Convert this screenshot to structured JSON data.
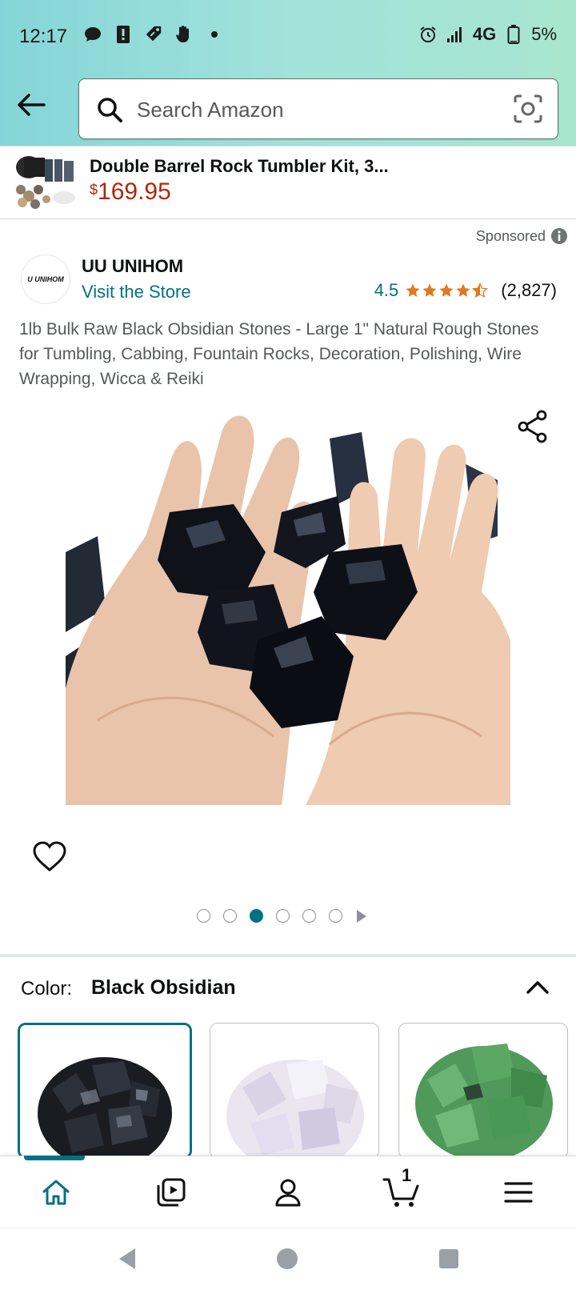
{
  "status_bar": {
    "time": "12:17",
    "network": "4G",
    "battery": "5%"
  },
  "header": {
    "search_placeholder": "Search Amazon"
  },
  "promo": {
    "title": "Double Barrel Rock Tumbler Kit, 3...",
    "price_currency": "$",
    "price_value": "169.95"
  },
  "sponsored_label": "Sponsored",
  "product": {
    "brand": "UU UNIHOM",
    "brand_logo_text": "U UNIHOM",
    "visit_store": "Visit the Store",
    "rating": "4.5",
    "rating_count": "(2,827)",
    "stars_filled": 4.5,
    "title": "1lb Bulk Raw Black Obsidian Stones - Large 1\" Natural Rough Stones for Tumbling, Cabbing, Fountain Rocks, Decoration, Polishing, Wire Wrapping, Wicca & Reiki",
    "image_count": 6,
    "active_image_index": 2
  },
  "color_section": {
    "label": "Color:",
    "selected": "Black Obsidian",
    "swatches": [
      "black-obsidian",
      "clear-quartz",
      "green-aventurine"
    ]
  },
  "bottom_nav": {
    "items": [
      "home-icon",
      "video-icon",
      "account-icon",
      "cart-icon",
      "menu-icon"
    ],
    "cart_count": "1"
  },
  "colors": {
    "accent": "#007185",
    "price": "#b12704",
    "star": "#de7921"
  }
}
